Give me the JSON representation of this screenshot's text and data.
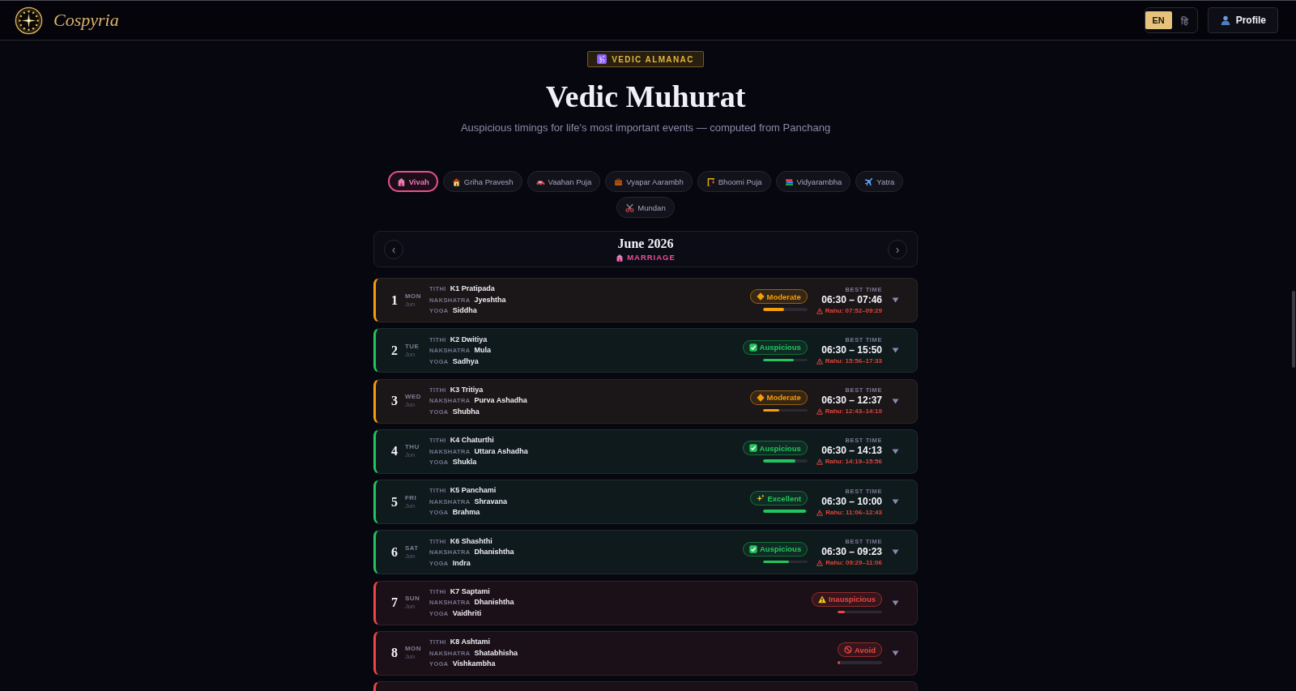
{
  "header": {
    "brand": "Cospyria",
    "languages": [
      {
        "label": "EN",
        "selected": true
      },
      {
        "label": "हि",
        "selected": false
      }
    ],
    "profile_button": "Profile"
  },
  "hero": {
    "badge": "VEDIC ALMANAC",
    "title": "Vedic Muhurat",
    "subtitle": "Auspicious timings for life's most important events — computed from Panchang"
  },
  "event_tabs": [
    {
      "label": "Vivah",
      "selected": true
    },
    {
      "label": "Griha Pravesh",
      "selected": false
    },
    {
      "label": "Vaahan Puja",
      "selected": false
    },
    {
      "label": "Vyapar Aarambh",
      "selected": false
    },
    {
      "label": "Bhoomi Puja",
      "selected": false
    },
    {
      "label": "Vidyarambha",
      "selected": false
    },
    {
      "label": "Yatra",
      "selected": false
    },
    {
      "label": "Mundan",
      "selected": false
    }
  ],
  "month_nav": {
    "prev": "‹",
    "month": "June 2026",
    "event": "MARRIAGE",
    "next": "›"
  },
  "days": [
    {
      "day": "1",
      "weekday": "MON",
      "month": "Jun",
      "fields": [
        {
          "label": "TITHI",
          "value": "K1 Pratipada"
        },
        {
          "label": "NAKSHATRA",
          "value": "Jyeshtha"
        },
        {
          "label": "YOGA",
          "value": "Siddha"
        }
      ],
      "kind": "moderate",
      "rating": "Moderate",
      "level": 0.48,
      "best_time_label": "BEST TIME",
      "best_time": "06:30 – 07:46",
      "rahu": "Rahu: 07:52–09:29",
      "expanded": false
    },
    {
      "day": "2",
      "weekday": "TUE",
      "month": "Jun",
      "fields": [
        {
          "label": "TITHI",
          "value": "K2 Dwitiya"
        },
        {
          "label": "NAKSHATRA",
          "value": "Mula"
        },
        {
          "label": "YOGA",
          "value": "Sadhya"
        }
      ],
      "kind": "auspicious",
      "rating": "Auspicious",
      "level": 0.7,
      "best_time_label": "BEST TIME",
      "best_time": "06:30 – 15:50",
      "rahu": "Rahu: 15:56–17:33",
      "expanded": false
    },
    {
      "day": "3",
      "weekday": "WED",
      "month": "Jun",
      "fields": [
        {
          "label": "TITHI",
          "value": "K3 Tritiya"
        },
        {
          "label": "NAKSHATRA",
          "value": "Purva Ashadha"
        },
        {
          "label": "YOGA",
          "value": "Shubha"
        }
      ],
      "kind": "moderate",
      "rating": "Moderate",
      "level": 0.37,
      "best_time_label": "BEST TIME",
      "best_time": "06:30 – 12:37",
      "rahu": "Rahu: 12:43–14:19",
      "expanded": false
    },
    {
      "day": "4",
      "weekday": "THU",
      "month": "Jun",
      "fields": [
        {
          "label": "TITHI",
          "value": "K4 Chaturthi"
        },
        {
          "label": "NAKSHATRA",
          "value": "Uttara Ashadha"
        },
        {
          "label": "YOGA",
          "value": "Shukla"
        }
      ],
      "kind": "auspicious",
      "rating": "Auspicious",
      "level": 0.73,
      "best_time_label": "BEST TIME",
      "best_time": "06:30 – 14:13",
      "rahu": "Rahu: 14:19–15:56",
      "expanded": false
    },
    {
      "day": "5",
      "weekday": "FRI",
      "month": "Jun",
      "fields": [
        {
          "label": "TITHI",
          "value": "K5 Panchami"
        },
        {
          "label": "NAKSHATRA",
          "value": "Shravana"
        },
        {
          "label": "YOGA",
          "value": "Brahma"
        }
      ],
      "kind": "excellent",
      "rating": "Excellent",
      "level": 0.96,
      "best_time_label": "BEST TIME",
      "best_time": "06:30 – 10:00",
      "rahu": "Rahu: 11:06–12:43",
      "expanded": false
    },
    {
      "day": "6",
      "weekday": "SAT",
      "month": "Jun",
      "fields": [
        {
          "label": "TITHI",
          "value": "K6 Shashthi"
        },
        {
          "label": "NAKSHATRA",
          "value": "Dhanishtha"
        },
        {
          "label": "YOGA",
          "value": "Indra"
        }
      ],
      "kind": "auspicious",
      "rating": "Auspicious",
      "level": 0.57,
      "best_time_label": "BEST TIME",
      "best_time": "06:30 – 09:23",
      "rahu": "Rahu: 09:29–11:06",
      "expanded": false
    },
    {
      "day": "7",
      "weekday": "SUN",
      "month": "Jun",
      "fields": [
        {
          "label": "TITHI",
          "value": "K7 Saptami"
        },
        {
          "label": "NAKSHATRA",
          "value": "Dhanishtha"
        },
        {
          "label": "YOGA",
          "value": "Vaidhriti"
        }
      ],
      "kind": "inauspicious",
      "rating": "Inauspicious",
      "level": 0.17,
      "expanded": false
    },
    {
      "day": "8",
      "weekday": "MON",
      "month": "Jun",
      "fields": [
        {
          "label": "TITHI",
          "value": "K8 Ashtami"
        },
        {
          "label": "NAKSHATRA",
          "value": "Shatabhisha"
        },
        {
          "label": "YOGA",
          "value": "Vishkambha"
        }
      ],
      "kind": "avoid",
      "rating": "Avoid",
      "level": 0.06,
      "expanded": false
    }
  ],
  "cut_off_day": {
    "kind": "inauspicious"
  }
}
